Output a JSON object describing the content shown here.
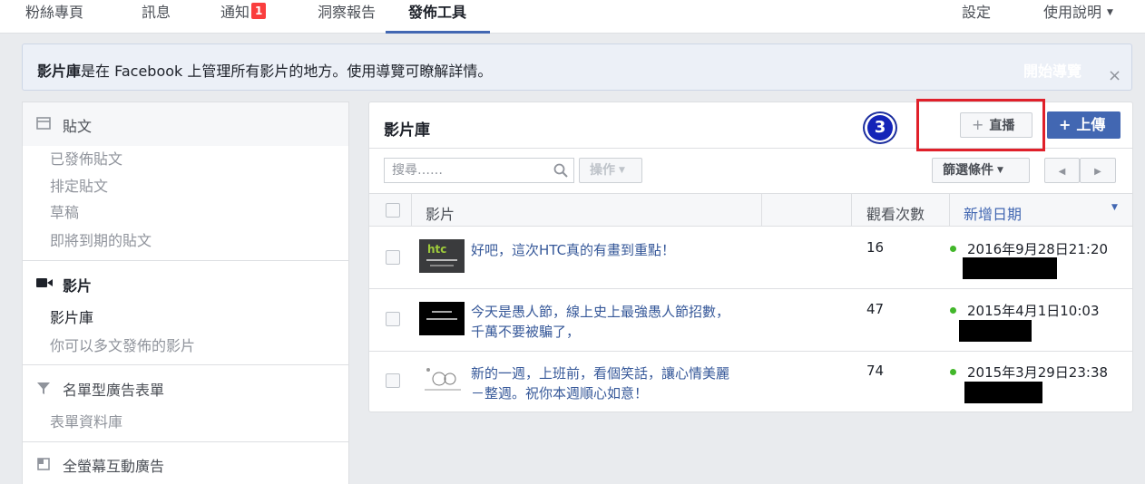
{
  "nav": {
    "tabs": [
      "粉絲專頁",
      "訊息",
      "通知",
      "洞察報告",
      "發佈工具"
    ],
    "notif_badge": "1",
    "right": [
      "設定",
      "使用說明"
    ]
  },
  "banner": {
    "bold": "影片庫",
    "text": "是在 Facebook 上管理所有影片的地方。使用導覽可瞭解詳情。",
    "start": "開始導覽",
    "close": "×"
  },
  "sidebar": {
    "posts": "貼文",
    "post_items": [
      "已發佈貼文",
      "排定貼文",
      "草稿",
      "即將到期的貼文"
    ],
    "videos": "影片",
    "video_items": [
      "影片庫",
      "你可以多文發佈的影片"
    ],
    "leads": "名單型廣告表單",
    "lead_items": [
      "表單資料庫"
    ],
    "canvas": "全螢幕互動廣告"
  },
  "main": {
    "title": "影片庫",
    "step": "3",
    "live": "直播",
    "upload": "上傳",
    "search_placeholder": "搜尋……",
    "actions": "操作",
    "filter": "篩選條件",
    "col_video": "影片",
    "col_views": "觀看次數",
    "col_date": "新增日期",
    "rows": [
      {
        "title": "好吧，這次HTC真的有畫到重點！",
        "views": "16",
        "date": "2016年9月28日21:20"
      },
      {
        "title": "今天是愚人節，線上史上最強愚人節招數，千萬不要被騙了，",
        "views": "47",
        "date": "2015年4月1日10:03"
      },
      {
        "title": "新的一週，上班前，看個笑話，讓心情美麗－整週。祝你本週順心如意！",
        "views": "74",
        "date": "2015年3月29日23:38"
      }
    ]
  }
}
